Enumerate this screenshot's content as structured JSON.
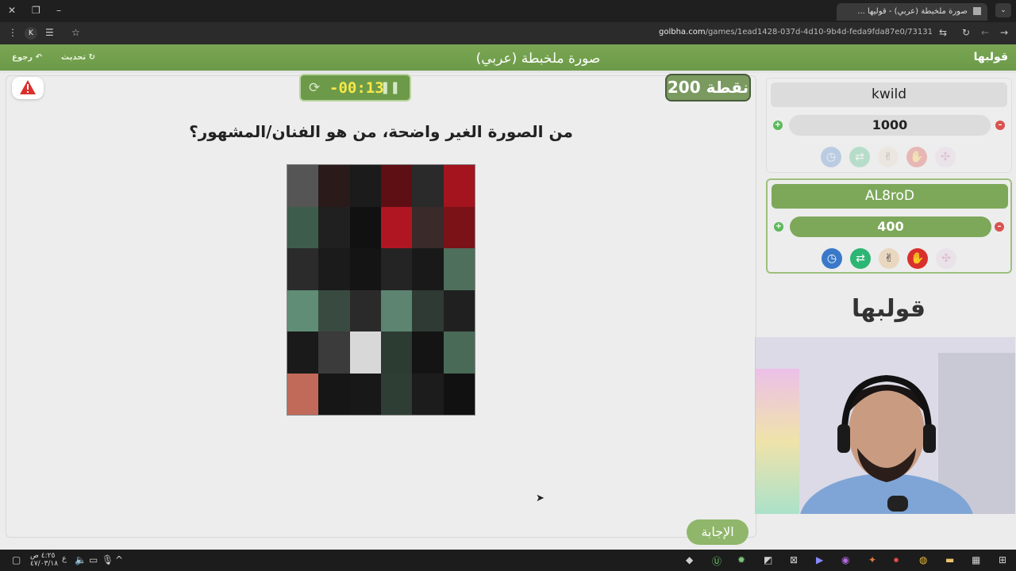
{
  "browser": {
    "tab_title": "صورة ملخبطة (عربي) - قوليها ...",
    "url_domain": "golbha.com",
    "url_path": "/games/1ead1428-037d-4d10-9b4d-feda9fda87e0/73131",
    "extension_letter": "K"
  },
  "header": {
    "back_label": "رجوع",
    "refresh_label": "تحديث",
    "title": "صورة ملخبطة (عربي)",
    "logo": "قولبها"
  },
  "game": {
    "timer": "-00:13",
    "points": "200 نقطة",
    "question": "من الصورة الغير واضحة، من هو الفنان/المشهور؟",
    "answer_button": "الإجابة"
  },
  "players": [
    {
      "name": "kwild",
      "score": "1000",
      "active": false
    },
    {
      "name": "AL8roD",
      "score": "400",
      "active": true
    }
  ],
  "brand_logo": "قولبها",
  "taskbar": {
    "time": "٤:٢٥ ص",
    "date": "٤٧/٠٣/١٨",
    "lang": "ع"
  },
  "colors": {
    "accent_green": "#6c9a48",
    "timer_text": "#f7e84a",
    "warning_red": "#d9302c"
  },
  "puzzle_tiles": [
    "#555",
    "#2a1a1a",
    "#1b1b1b",
    "#5d0f14",
    "#2a2a2a",
    "#a3141e",
    "#3e5c4c",
    "#202020",
    "#111",
    "#b01622",
    "#3a2a2a",
    "#7a1218",
    "#2b2b2b",
    "#1b1b1b",
    "#141414",
    "#242424",
    "#191919",
    "#4d6f5c",
    "#5f8d76",
    "#394a40",
    "#2a2a2a",
    "#5c8470",
    "#2f3a34",
    "#202020",
    "#1a1a1a",
    "#3b3b3b",
    "#d8d8d8",
    "#2c3c33",
    "#141414",
    "#4a6a58",
    "#c26a5a",
    "#161616",
    "#181818",
    "#2e3e34",
    "#1c1c1c",
    "#111111"
  ]
}
